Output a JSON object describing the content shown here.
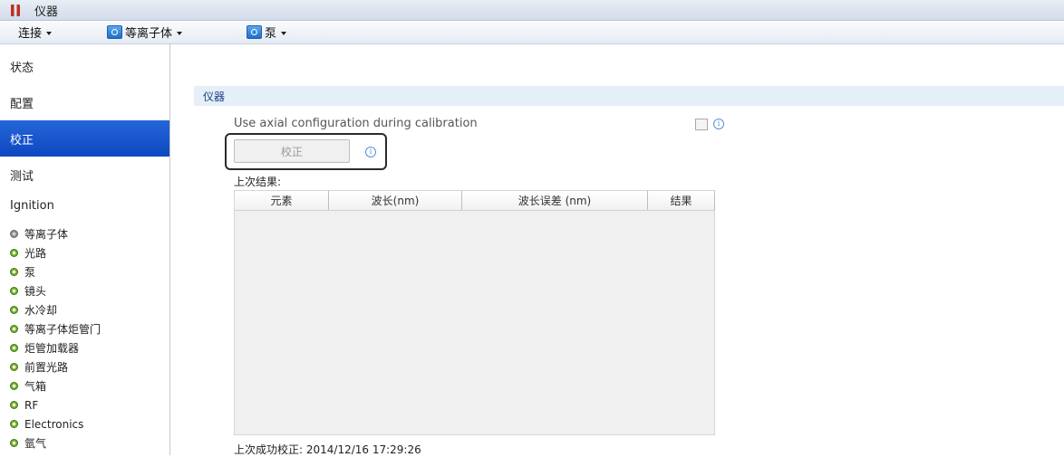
{
  "window": {
    "title": "仪器",
    "app_icon": "instrument-icon"
  },
  "menubar": {
    "items": [
      {
        "label": "连接",
        "icon": null
      },
      {
        "label": "等离子体",
        "icon": "plasma-icon"
      },
      {
        "label": "泵",
        "icon": "pump-icon"
      }
    ]
  },
  "sidebar": {
    "nav": [
      {
        "label": "状态"
      },
      {
        "label": "配置"
      },
      {
        "label": "校正",
        "active": true
      },
      {
        "label": "测试"
      }
    ],
    "section_title": "Ignition",
    "status_items": [
      {
        "label": "等离子体",
        "status": "gray"
      },
      {
        "label": "光路",
        "status": "green"
      },
      {
        "label": "泵",
        "status": "green"
      },
      {
        "label": "镜头",
        "status": "green"
      },
      {
        "label": "水冷却",
        "status": "green"
      },
      {
        "label": "等离子体炬管门",
        "status": "green"
      },
      {
        "label": "炬管加载器",
        "status": "green"
      },
      {
        "label": "前置光路",
        "status": "green"
      },
      {
        "label": "气箱",
        "status": "green"
      },
      {
        "label": "RF",
        "status": "green"
      },
      {
        "label": "Electronics",
        "status": "green"
      },
      {
        "label": "氩气",
        "status": "green"
      }
    ],
    "status_colors": {
      "green": "#6aa82a",
      "gray": "#8a8a8a"
    }
  },
  "main": {
    "section_header": "仪器",
    "axial_label": "Use axial configuration during calibration",
    "axial_checked": false,
    "calibrate_button": "校正",
    "calibrate_enabled": false,
    "last_result_label": "上次结果:",
    "table": {
      "columns": [
        "元素",
        "波长(nm)",
        "波长误差 (nm)",
        "结果"
      ],
      "rows": []
    },
    "last_success_label": "上次成功校正:",
    "last_success_time": "2014/12/16 17:29:26"
  },
  "colors": {
    "accent": "#1652c8",
    "section_header_bg": "#e6eef8",
    "section_header_text": "#1b3d86"
  }
}
